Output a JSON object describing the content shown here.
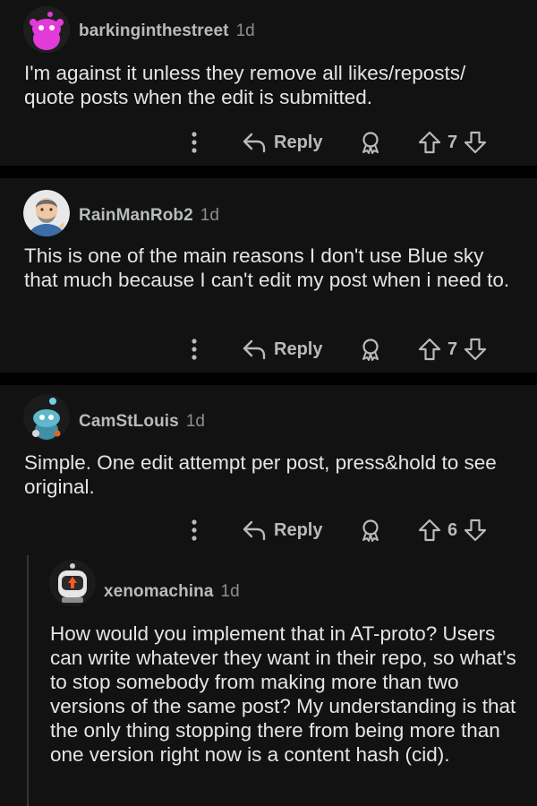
{
  "comments": [
    {
      "username": "barkinginthestreet",
      "age": "1d",
      "body": "I'm against it unless they remove all likes/reposts/ quote posts when the edit is submitted.",
      "reply_label": "Reply",
      "score": "7",
      "avatar": "magenta-snoo-avatar"
    },
    {
      "username": "RainManRob2",
      "age": "1d",
      "body": "This is one of the main reasons I don't use Blue sky that much because I can't edit my post when i need to.",
      "reply_label": "Reply",
      "score": "7",
      "avatar": "bearded-man-avatar"
    },
    {
      "username": "CamStLouis",
      "age": "1d",
      "body": "Simple. One edit attempt per post, press&hold to see original.",
      "reply_label": "Reply",
      "score": "6",
      "avatar": "teal-snoo-avatar"
    },
    {
      "username": "xenomachina",
      "age": "1d",
      "body": "How would you implement that in AT-proto? Users can write whatever they want in their repo, so what's to stop somebody from making more than two versions of the same post? My understanding is that the only thing stopping there from being more than one version right now is a content hash (cid).",
      "avatar": "robot-snoo-avatar"
    }
  ],
  "colors": {
    "background": "#000000",
    "card": "#121212",
    "text": "#e3e5e6",
    "muted": "#b7bbbd"
  }
}
